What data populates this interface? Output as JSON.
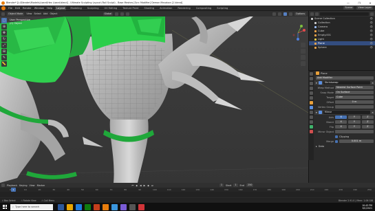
{
  "window": {
    "title": "Blender* [L:\\Blender\\Models\\Lizard\\Hex Lizard.blend] - Ultimate Sculpting Layout (Roll Sculpt) - Base Meshes [Scn: Modifier] Demon Mecabon [1 blend]",
    "controls": [
      "—",
      "❐",
      "✕"
    ]
  },
  "menubar": {
    "menus": [
      "File",
      "Edit",
      "Render",
      "Window",
      "Help"
    ],
    "workspaces": [
      "Layout",
      "Modeling",
      "Sculpting",
      "UV Editing",
      "Texture Paint",
      "Shading",
      "Animation",
      "Rendering",
      "Compositing",
      "Scripting"
    ],
    "active_workspace": "Layout",
    "scene_label": "Scene",
    "view_layer_label": "View Layer"
  },
  "viewport_header": {
    "mode": "Object Mode",
    "menus": [
      "View",
      "Select",
      "Add",
      "Object"
    ],
    "orientation": "Global",
    "options_label": "Options"
  },
  "viewport_info": {
    "line1": "User Perspective",
    "line2": "(0) Object"
  },
  "outliner": {
    "title": "Scene Collection",
    "items": [
      {
        "label": "Scene Collection",
        "color": "#cfcfcf",
        "selected": false
      },
      {
        "label": "Collection",
        "color": "#cfcfcf",
        "selected": false
      },
      {
        "label": "Camera",
        "color": "#9ec1ff",
        "selected": false
      },
      {
        "label": "Cube",
        "color": "#f2a54a",
        "selected": false
      },
      {
        "label": "Empty.001",
        "color": "#f2a54a",
        "selected": false
      },
      {
        "label": "Light",
        "color": "#f2d24a",
        "selected": false
      },
      {
        "label": "Plane",
        "color": "#f2a54a",
        "selected": true
      },
      {
        "label": "Sphere",
        "color": "#f2a54a",
        "selected": false
      }
    ]
  },
  "properties": {
    "object_name": "Plane",
    "modifier_add": "Add Modifier",
    "modifier_name": "Shrinkwrap",
    "rows": [
      {
        "label": "Wrap Method",
        "value": "Nearest Surface Point"
      },
      {
        "label": "Snap Mode",
        "value": "On Surface"
      },
      {
        "label": "Target",
        "value": "Cube"
      },
      {
        "label": "Offset",
        "value": "0 m"
      },
      {
        "label": "Vertex Group",
        "value": ""
      }
    ],
    "mirror_name": "Mirror",
    "axis_rows": [
      {
        "label": "Axis",
        "values": [
          "X",
          "Y",
          "Z"
        ]
      },
      {
        "label": "Bisect",
        "values": [
          "X",
          "Y",
          "Z"
        ]
      },
      {
        "label": "Flip",
        "values": [
          "X",
          "Y",
          "Z"
        ]
      }
    ],
    "mirror_object_label": "Mirror Object",
    "clipping_label": "Clipping",
    "merge_label": "Merge",
    "merge_value": "0.001 m",
    "data_label": "Data"
  },
  "timeline": {
    "menus": [
      "Playback",
      "Keying",
      "View",
      "Marker"
    ],
    "current_frame": "1",
    "start_label": "Start",
    "start": "1",
    "end_label": "End",
    "end": "250",
    "ticks": [
      "0",
      "10",
      "20",
      "30",
      "40",
      "50",
      "60",
      "70",
      "80",
      "90",
      "100",
      "110",
      "120",
      "130",
      "140",
      "150",
      "160",
      "170",
      "180",
      "190",
      "200",
      "210",
      "220",
      "230",
      "240",
      "250"
    ]
  },
  "statusbar": {
    "left": "Box Select",
    "middle": "Rotate View",
    "right_hint": "Call Menu",
    "stats": "Blender 2.91.0 | Mem: 1.06 GiB"
  },
  "taskbar": {
    "search_placeholder": "Type here to search",
    "time": "10:43 PM",
    "date": "6/1/2021",
    "apps": [
      "#2b579a",
      "#e8a500",
      "#1e7be0",
      "#0f7b0f",
      "#c43e1c",
      "#e87d0d",
      "#3a96dd",
      "#7a5cd6",
      "#555555",
      "#d13438"
    ]
  },
  "colors": {
    "accent": "#4772b3",
    "mesh_green": "#22c55e",
    "mesh_grey": "#bdbdbd"
  }
}
